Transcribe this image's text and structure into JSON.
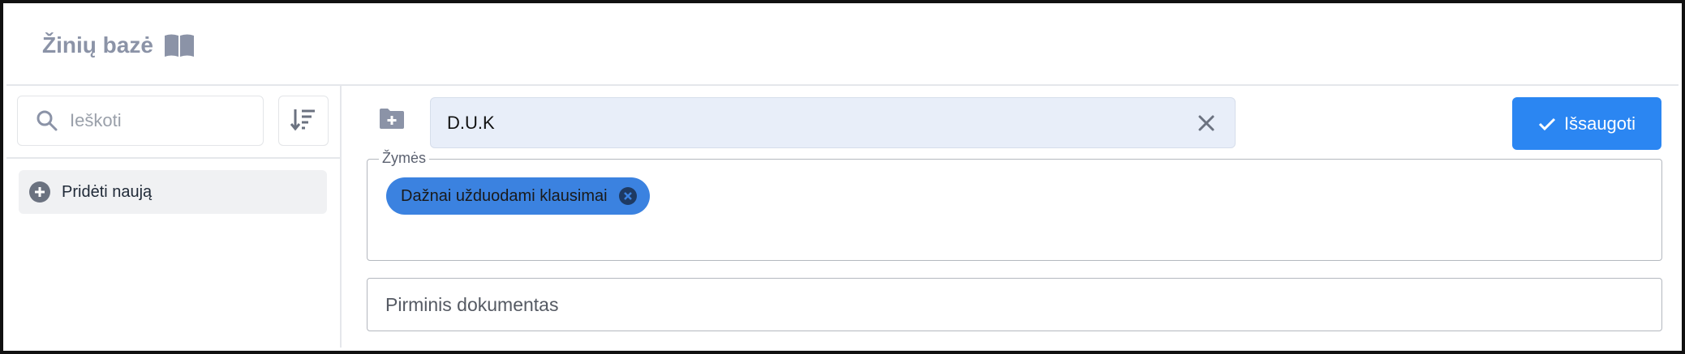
{
  "header": {
    "title": "Žinių bazė",
    "icon": "book-icon"
  },
  "sidebar": {
    "search": {
      "placeholder": "Ieškoti",
      "icon": "search-icon"
    },
    "sort": {
      "icon": "sort-icon"
    },
    "add_new_label": "Pridėti naują"
  },
  "main": {
    "folder_icon": "folder-plus-icon",
    "name_value": "D.U.K",
    "save_label": "Išsaugoti",
    "tags_label": "Žymės",
    "tags": [
      {
        "label": "Dažnai užduodami klausimai"
      }
    ],
    "document_placeholder": "Pirminis dokumentas"
  },
  "colors": {
    "accent": "#2b86f2",
    "chip": "#3b82e0",
    "name_field_bg": "#e8eef9",
    "muted_title": "#8b93a7"
  }
}
